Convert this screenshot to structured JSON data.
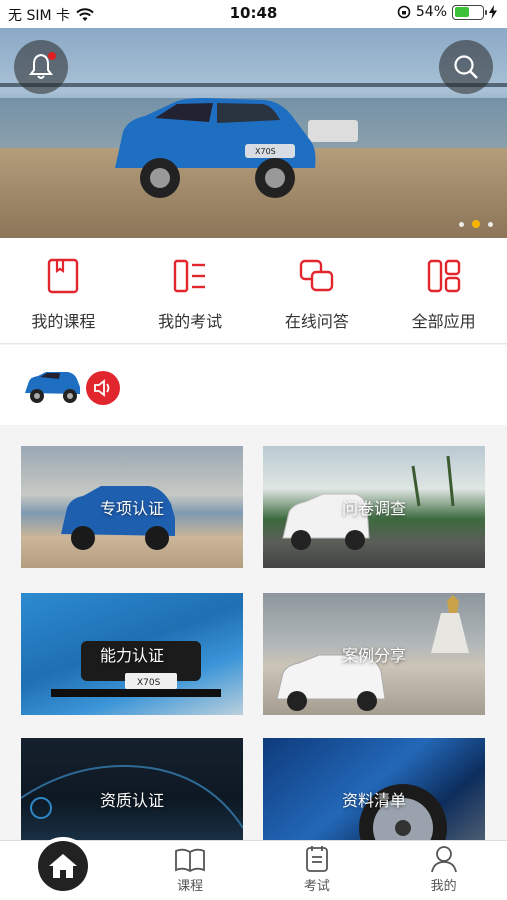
{
  "status_bar": {
    "carrier": "无 SIM 卡",
    "time": "10:48",
    "battery": "54%",
    "battery_level": 0.54
  },
  "banner": {
    "active_slide": 2,
    "slide_count": 3,
    "car_badge": "X70S"
  },
  "quick_menu": [
    {
      "label": "我的课程",
      "icon": "course-book-icon"
    },
    {
      "label": "我的考试",
      "icon": "exam-list-icon"
    },
    {
      "label": "在线问答",
      "icon": "qa-bubbles-icon"
    },
    {
      "label": "全部应用",
      "icon": "apps-grid-icon"
    }
  ],
  "tiles": [
    {
      "label": "专项认证"
    },
    {
      "label": "问卷调查"
    },
    {
      "label": "能力认证",
      "badge": "X70S"
    },
    {
      "label": "案例分享"
    },
    {
      "label": "资质认证"
    },
    {
      "label": "资料清单"
    }
  ],
  "tab_bar": [
    {
      "label": "",
      "icon": "home-icon"
    },
    {
      "label": "课程",
      "icon": "book-open-icon"
    },
    {
      "label": "考试",
      "icon": "exam-paper-icon"
    },
    {
      "label": "我的",
      "icon": "profile-icon"
    }
  ],
  "colors": {
    "accent": "#e1262d",
    "indicator": "#f6b400",
    "battery": "#3cc13b"
  }
}
